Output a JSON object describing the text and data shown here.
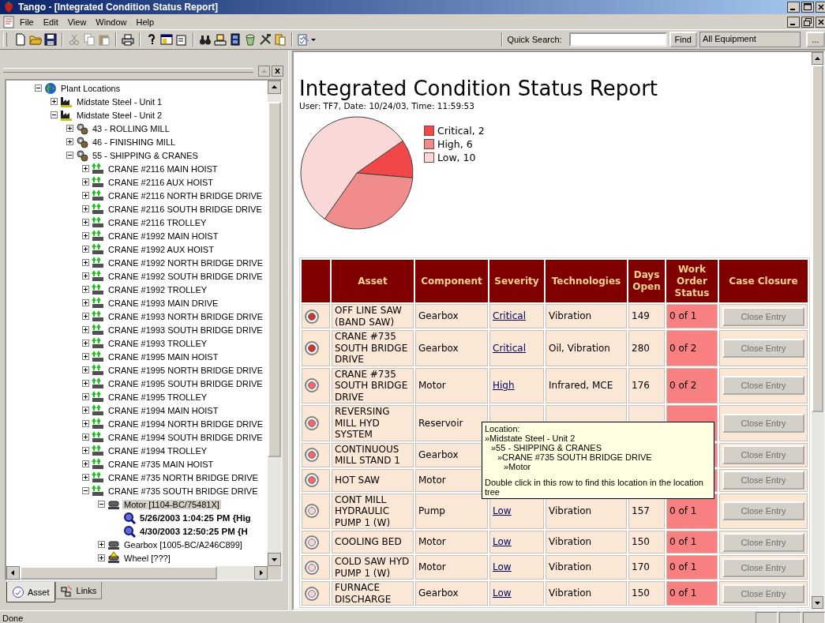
{
  "window": {
    "title": "Tango - [Integrated Condition Status Report]"
  },
  "menu": [
    "File",
    "Edit",
    "View",
    "Window",
    "Help"
  ],
  "toolbar": {
    "quick_search_label": "Quick Search:",
    "find_button": "Find",
    "scope_field": "All Equipment",
    "browse_button": "..."
  },
  "tree": {
    "items": [
      {
        "label": "Plant Locations",
        "kind": "globe",
        "expanded": true,
        "selected": false,
        "children": [
          {
            "label": "Midstate Steel - Unit 1",
            "kind": "plant",
            "expanded": false,
            "selected": false
          },
          {
            "label": "Midstate Steel - Unit 2",
            "kind": "plant",
            "expanded": true,
            "selected": false,
            "children": [
              {
                "label": "43 - ROLLING MILL",
                "kind": "area",
                "expanded": false,
                "selected": false
              },
              {
                "label": "46 - FINISHING MILL",
                "kind": "area",
                "expanded": false,
                "selected": false
              },
              {
                "label": "55 - SHIPPING & CRANES",
                "kind": "area",
                "expanded": true,
                "selected": false,
                "children": [
                  {
                    "label": "CRANE #2116 MAIN HOIST",
                    "kind": "machine",
                    "expanded": false,
                    "selected": false
                  },
                  {
                    "label": "CRANE #2116 AUX HOIST",
                    "kind": "machine",
                    "expanded": false,
                    "selected": false
                  },
                  {
                    "label": "CRANE #2116 NORTH BRIDGE DRIVE",
                    "kind": "machine",
                    "expanded": false,
                    "selected": false
                  },
                  {
                    "label": "CRANE #2116 SOUTH BRIDGE DRIVE",
                    "kind": "machine",
                    "expanded": false,
                    "selected": false
                  },
                  {
                    "label": "CRANE #2116 TROLLEY",
                    "kind": "machine",
                    "expanded": false,
                    "selected": false
                  },
                  {
                    "label": "CRANE #1992 MAIN HOIST",
                    "kind": "machine",
                    "expanded": false,
                    "selected": false
                  },
                  {
                    "label": "CRANE #1992 AUX HOIST",
                    "kind": "machine",
                    "expanded": false,
                    "selected": false
                  },
                  {
                    "label": "CRANE #1992 NORTH BRIDGE DRIVE",
                    "kind": "machine",
                    "expanded": false,
                    "selected": false
                  },
                  {
                    "label": "CRANE #1992 SOUTH BRIDGE DRIVE",
                    "kind": "machine",
                    "expanded": false,
                    "selected": false
                  },
                  {
                    "label": "CRANE #1992 TROLLEY",
                    "kind": "machine",
                    "expanded": false,
                    "selected": false
                  },
                  {
                    "label": "CRANE #1993 MAIN DRIVE",
                    "kind": "machine",
                    "expanded": false,
                    "selected": false
                  },
                  {
                    "label": "CRANE #1993 NORTH BRIDGE DRIVE",
                    "kind": "machine",
                    "expanded": false,
                    "selected": false
                  },
                  {
                    "label": "CRANE #1993 SOUTH BRIDGE DRIVE",
                    "kind": "machine",
                    "expanded": false,
                    "selected": false
                  },
                  {
                    "label": "CRANE #1993 TROLLEY",
                    "kind": "machine",
                    "expanded": false,
                    "selected": false
                  },
                  {
                    "label": "CRANE #1995 MAIN HOIST",
                    "kind": "machine",
                    "expanded": false,
                    "selected": false
                  },
                  {
                    "label": "CRANE #1995 NORTH BRIDGE DRIVE",
                    "kind": "machine",
                    "expanded": false,
                    "selected": false
                  },
                  {
                    "label": "CRANE #1995 SOUTH BRIDGE DRIVE",
                    "kind": "machine",
                    "expanded": false,
                    "selected": false
                  },
                  {
                    "label": "CRANE #1995 TROLLEY",
                    "kind": "machine",
                    "expanded": false,
                    "selected": false
                  },
                  {
                    "label": "CRANE #1994 MAIN HOIST",
                    "kind": "machine",
                    "expanded": false,
                    "selected": false
                  },
                  {
                    "label": "CRANE #1994 NORTH BRIDGE DRIVE",
                    "kind": "machine",
                    "expanded": false,
                    "selected": false
                  },
                  {
                    "label": "CRANE #1994 SOUTH BRIDGE DRIVE",
                    "kind": "machine",
                    "expanded": false,
                    "selected": false
                  },
                  {
                    "label": "CRANE #1994 TROLLEY",
                    "kind": "machine",
                    "expanded": false,
                    "selected": false
                  },
                  {
                    "label": "CRANE #735 MAIN HOIST",
                    "kind": "machine",
                    "expanded": false,
                    "selected": false
                  },
                  {
                    "label": "CRANE #735 NORTH BRIDGE DRIVE",
                    "kind": "machine",
                    "expanded": false,
                    "selected": false
                  },
                  {
                    "label": "CRANE #735 SOUTH BRIDGE DRIVE",
                    "kind": "machine",
                    "expanded": true,
                    "selected": false,
                    "children": [
                      {
                        "label": "Motor [1104-BC/75481X]",
                        "kind": "component",
                        "expanded": true,
                        "selected": true,
                        "children": [
                          {
                            "label": "5/26/2003 1:04:25 PM {Hig",
                            "kind": "reading",
                            "selected": false
                          },
                          {
                            "label": "4/30/2003 12:50:25 PM {H",
                            "kind": "reading",
                            "selected": false
                          }
                        ]
                      },
                      {
                        "label": "Gearbox [1005-BC/A246C899]",
                        "kind": "component",
                        "expanded": false,
                        "selected": false
                      },
                      {
                        "label": "Wheel [???]",
                        "kind": "component-alert",
                        "expanded": false,
                        "selected": false
                      }
                    ]
                  }
                ]
              }
            ]
          }
        ]
      }
    ]
  },
  "tabs": [
    {
      "label": "Asset",
      "selected": true
    },
    {
      "label": "Links",
      "selected": false
    }
  ],
  "report": {
    "title": "Integrated Condition Status Report",
    "subtitle": "User: TF7, Date: 10/24/03, Time: 11:59:53",
    "chart_data": {
      "type": "pie",
      "categories": [
        "Critical, 2",
        "High, 6",
        "Low, 10"
      ],
      "values": [
        2,
        6,
        10
      ]
    },
    "legend": [
      {
        "color": "#f04848"
      },
      {
        "color": "#f08c8c"
      },
      {
        "color": "#fbd8d8"
      }
    ],
    "columns": [
      "",
      "Asset",
      "Component",
      "Severity",
      "Technologies",
      "Days Open",
      "Work Order Status",
      "Case Closure"
    ],
    "rows": [
      {
        "color": "#c83434",
        "asset": "OFF LINE SAW (BAND SAW)",
        "component": "Gearbox",
        "severity": "Critical",
        "technologies": "Vibration",
        "days_open": "149",
        "work_order": "0 of 1",
        "action": "Close Entry",
        "disabled": true
      },
      {
        "color": "#c83434",
        "asset": "CRANE #735 SOUTH BRIDGE DRIVE",
        "component": "Gearbox",
        "severity": "Critical",
        "technologies": "Oil, Vibration",
        "days_open": "280",
        "work_order": "0 of 2",
        "action": "Close Entry",
        "disabled": true
      },
      {
        "color": "#f06868",
        "asset": "CRANE #735 SOUTH BRIDGE DRIVE",
        "component": "Motor",
        "severity": "High",
        "technologies": "Infrared, MCE",
        "days_open": "176",
        "work_order": "0 of 2",
        "action": "Close Entry",
        "disabled": true
      },
      {
        "color": "#f06868",
        "asset": "REVERSING MILL HYD SYSTEM",
        "component": "Reservoir",
        "action": "Close Entry",
        "disabled": true
      },
      {
        "color": "#f06868",
        "asset": "CONTINUOUS MILL STAND 1",
        "component": "Gearbox",
        "action": "Close Entry",
        "disabled": true
      },
      {
        "color": "#f06868",
        "asset": "HOT SAW",
        "component": "Motor",
        "action": "Close Entry",
        "disabled": true
      },
      {
        "color": "#f4d4d4",
        "asset": "CONT MILL HYDRAULIC PUMP 1 (W)",
        "component": "Pump",
        "severity": "Low",
        "technologies": "Vibration",
        "days_open": "157",
        "work_order": "0 of 1",
        "action": "Close Entry",
        "disabled": true
      },
      {
        "color": "#f4d4d4",
        "asset": "COOLING BED",
        "component": "Motor",
        "severity": "Low",
        "technologies": "Vibration",
        "days_open": "150",
        "work_order": "0 of 1",
        "action": "Close Entry",
        "disabled": true
      },
      {
        "color": "#f4d4d4",
        "asset": "COLD SAW HYD PUMP 1 (W)",
        "component": "Motor",
        "severity": "Low",
        "technologies": "Vibration",
        "days_open": "170",
        "work_order": "0 of 1",
        "action": "Close Entry",
        "disabled": true
      },
      {
        "color": "#f4d4d4",
        "asset": "FURNACE DISCHARGE",
        "component": "Gearbox",
        "severity": "Low",
        "technologies": "Vibration",
        "days_open": "150",
        "work_order": "0 of 1",
        "action": "Close Entry",
        "disabled": true
      }
    ],
    "tooltip": {
      "heading": "Location:",
      "path": [
        {
          "text": "»Midstate Steel - Unit 2",
          "children": [
            {
              "text": "»55 - SHIPPING & CRANES",
              "children": [
                {
                  "text": "»CRANE #735 SOUTH BRIDGE DRIVE",
                  "children": [
                    {
                      "text": "»Motor"
                    }
                  ]
                }
              ]
            }
          ]
        }
      ],
      "hint": "Double click in this row to find this location in the location tree"
    }
  },
  "status_bar": {
    "text": "Done"
  }
}
